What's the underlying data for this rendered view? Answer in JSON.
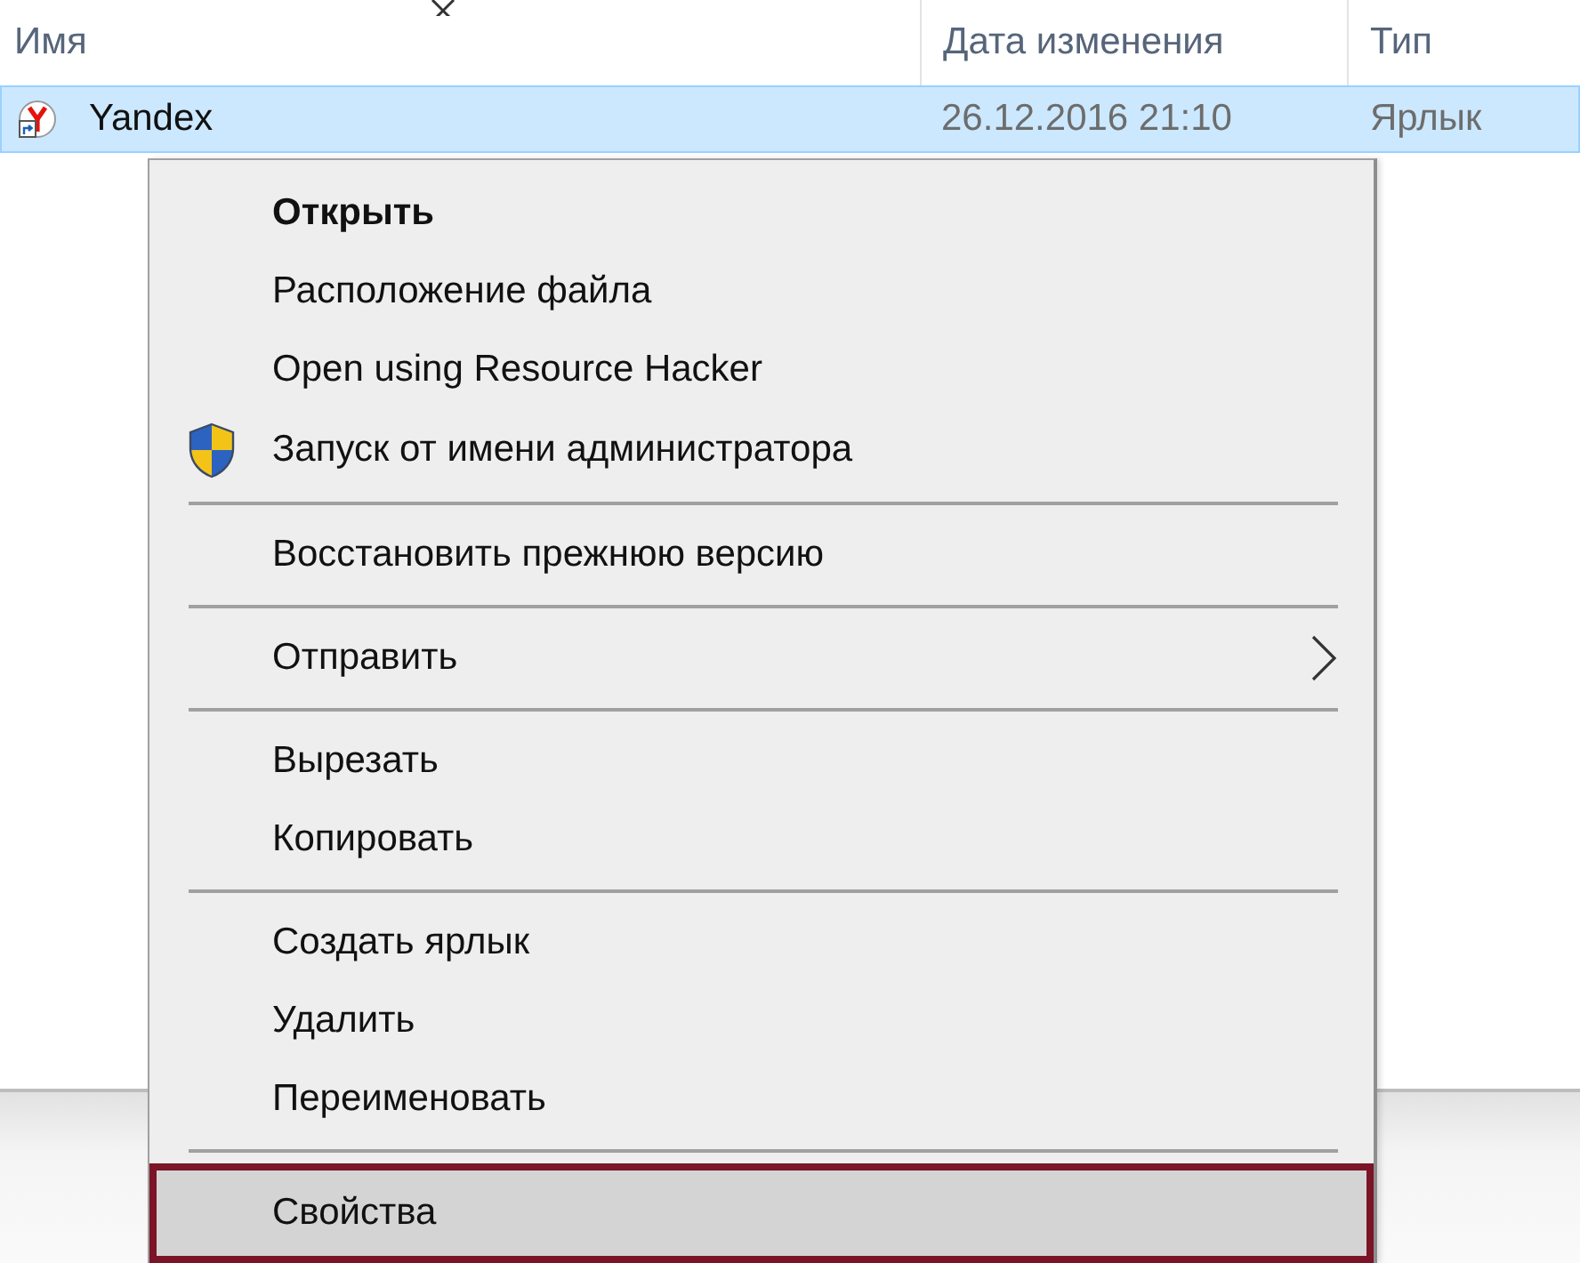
{
  "columns": [
    {
      "label": "Имя"
    },
    {
      "label": "Дата изменения"
    },
    {
      "label": "Тип"
    }
  ],
  "files": [
    {
      "name": "Yandex",
      "modified": "26.12.2016 21:10",
      "type": "Ярлык",
      "selected": true
    }
  ],
  "context_menu": {
    "items": [
      {
        "kind": "command",
        "label": "Открыть",
        "default": true,
        "selected": false
      },
      {
        "kind": "command",
        "label": "Расположение файла",
        "default": false,
        "selected": false
      },
      {
        "kind": "command",
        "label": "Open using Resource Hacker",
        "default": false,
        "selected": false
      },
      {
        "kind": "elevated",
        "label": "Запуск от имени администратора",
        "default": false,
        "selected": false
      },
      {
        "kind": "separator"
      },
      {
        "kind": "command",
        "label": "Восстановить прежнюю версию",
        "default": false,
        "selected": false
      },
      {
        "kind": "separator"
      },
      {
        "kind": "submenu",
        "label": "Отправить",
        "default": false,
        "selected": false
      },
      {
        "kind": "separator"
      },
      {
        "kind": "command",
        "label": "Вырезать",
        "default": false,
        "selected": false
      },
      {
        "kind": "command",
        "label": "Копировать",
        "default": false,
        "selected": false
      },
      {
        "kind": "separator"
      },
      {
        "kind": "command",
        "label": "Создать ярлык",
        "default": false,
        "selected": false
      },
      {
        "kind": "command",
        "label": "Удалить",
        "default": false,
        "selected": false
      },
      {
        "kind": "command",
        "label": "Переименовать",
        "default": false,
        "selected": false
      },
      {
        "kind": "separator"
      },
      {
        "kind": "command",
        "label": "Свойства",
        "default": false,
        "selected": true
      }
    ]
  }
}
